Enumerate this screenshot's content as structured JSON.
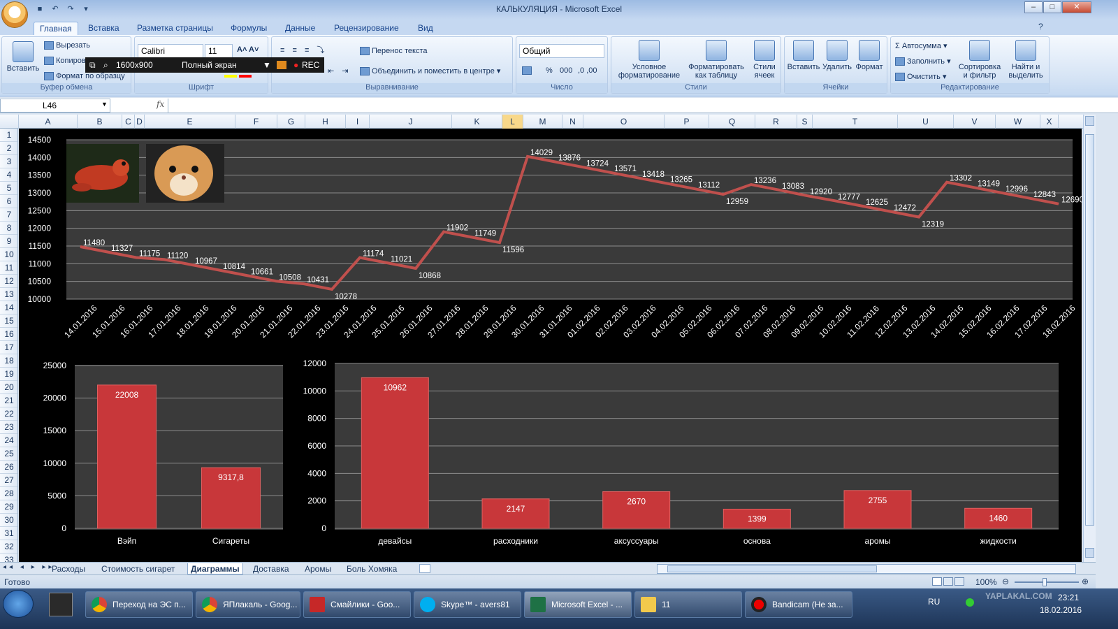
{
  "window": {
    "title": "КАЛЬКУЛЯЦИЯ - Microsoft Excel",
    "min": "–",
    "max": "□",
    "close": "✕"
  },
  "ribbon": {
    "tabs": [
      "Главная",
      "Вставка",
      "Разметка страницы",
      "Формулы",
      "Данные",
      "Рецензирование",
      "Вид"
    ],
    "clipboard": {
      "label": "Буфер обмена",
      "paste": "Вставить",
      "cut": "Вырезать",
      "copy": "Копиров",
      "format_painter": "Формат по образцу"
    },
    "font": {
      "label": "Шрифт",
      "name": "Calibri",
      "size": "11"
    },
    "alignment": {
      "label": "Выравнивание",
      "wrap": "Перенос текста",
      "merge": "Объединить и поместить в центре"
    },
    "number": {
      "label": "Число",
      "format": "Общий",
      "percent": "%",
      "thousands": "000"
    },
    "styles": {
      "label": "Стили",
      "conditional": "Условное форматирование",
      "as_table": "Форматировать как таблицу",
      "cell_styles": "Стили ячеек"
    },
    "cells": {
      "label": "Ячейки",
      "insert": "Вставить",
      "delete": "Удалить",
      "format": "Формат"
    },
    "editing": {
      "label": "Редактирование",
      "autosum": "Автосумма",
      "fill": "Заполнить",
      "clear": "Очистить",
      "sort": "Сортировка и фильтр",
      "find": "Найти и выделить"
    }
  },
  "bandicam": {
    "resolution": "1600x900",
    "mode": "Полный экран",
    "rec": "REC"
  },
  "formula_bar": {
    "name_box": "L46",
    "fx": "fx",
    "formula": ""
  },
  "columns": [
    "A",
    "B",
    "C",
    "D",
    "E",
    "F",
    "G",
    "H",
    "I",
    "J",
    "K",
    "L",
    "M",
    "N",
    "O",
    "P",
    "Q",
    "R",
    "S",
    "T",
    "U",
    "V",
    "W",
    "X"
  ],
  "selected_column": "L",
  "rows": [
    "1",
    "2",
    "3",
    "4",
    "5",
    "6",
    "7",
    "8",
    "9",
    "10",
    "11",
    "12",
    "13",
    "14",
    "15",
    "16",
    "17",
    "18",
    "19",
    "20",
    "21",
    "22",
    "23",
    "24",
    "25",
    "26",
    "27",
    "28",
    "29",
    "30",
    "31",
    "32",
    "33"
  ],
  "sheet_tabs": [
    "Расходы",
    "Стоимость сигарет",
    "Диаграммы",
    "Доставка",
    "Аромы",
    "Боль Хомяка"
  ],
  "active_sheet": "Диаграммы",
  "status": {
    "ready": "Готово",
    "zoom": "100%"
  },
  "taskbar": {
    "items": [
      "Переход на ЭС п...",
      "ЯПлакаль - Goog...",
      "Смайлики - Goo...",
      "Skype™ - avers81",
      "Microsoft Excel - ...",
      "11",
      "Bandicam (Не за..."
    ],
    "lang": "RU",
    "time": "23:21",
    "date": "18.02.2016",
    "watermark": "YAPLAKAL.COM"
  },
  "colors": {
    "bar": "#c8373a",
    "line": "#c0504d",
    "plot_bg": "#3a3a3a",
    "grid": "#8c8c8c"
  },
  "chart_data": [
    {
      "type": "line",
      "x": [
        "14.01.2016",
        "15.01.2016",
        "16.01.2016",
        "17.01.2016",
        "18.01.2016",
        "19.01.2016",
        "20.01.2016",
        "21.01.2016",
        "22.01.2016",
        "23.01.2016",
        "24.01.2016",
        "25.01.2016",
        "26.01.2016",
        "27.01.2016",
        "28.01.2016",
        "29.01.2016",
        "30.01.2016",
        "31.01.2016",
        "01.02.2016",
        "02.02.2016",
        "03.02.2016",
        "04.02.2016",
        "05.02.2016",
        "06.02.2016",
        "07.02.2016",
        "08.02.2016",
        "09.02.2016",
        "10.02.2016",
        "11.02.2016",
        "12.02.2016",
        "13.02.2016",
        "14.02.2016",
        "15.02.2016",
        "16.02.2016",
        "17.02.2016",
        "18.02.2016"
      ],
      "series": [
        {
          "values": [
            11480,
            11327,
            11175,
            11120,
            10967,
            10814,
            10661,
            10508,
            10431,
            10278,
            11174,
            11021,
            10868,
            11902,
            11749,
            11596,
            14029,
            13876,
            13724,
            13571,
            13418,
            13265,
            13112,
            12959,
            13236,
            13083,
            12920,
            12777,
            12625,
            12472,
            12319,
            13302,
            13149,
            12996,
            12843,
            12690
          ]
        }
      ],
      "ylim": [
        10000,
        14500
      ],
      "yticks": [
        10000,
        10500,
        11000,
        11500,
        12000,
        12500,
        13000,
        13500,
        14000,
        14500
      ],
      "grid": true
    },
    {
      "type": "bar",
      "categories": [
        "Вэйп",
        "Сигареты"
      ],
      "values": [
        22008,
        9317.8
      ],
      "labels": [
        "22008",
        "9317,8"
      ],
      "ylim": [
        0,
        25000
      ],
      "yticks": [
        0,
        5000,
        10000,
        15000,
        20000,
        25000
      ],
      "grid": true
    },
    {
      "type": "bar",
      "categories": [
        "девайсы",
        "расходники",
        "аксуссуары",
        "основа",
        "аромы",
        "жидкости"
      ],
      "values": [
        10962,
        2147,
        2670,
        1399,
        2755,
        1460
      ],
      "ylim": [
        0,
        12000
      ],
      "yticks": [
        0,
        2000,
        4000,
        6000,
        8000,
        10000,
        12000
      ],
      "grid": true
    }
  ]
}
